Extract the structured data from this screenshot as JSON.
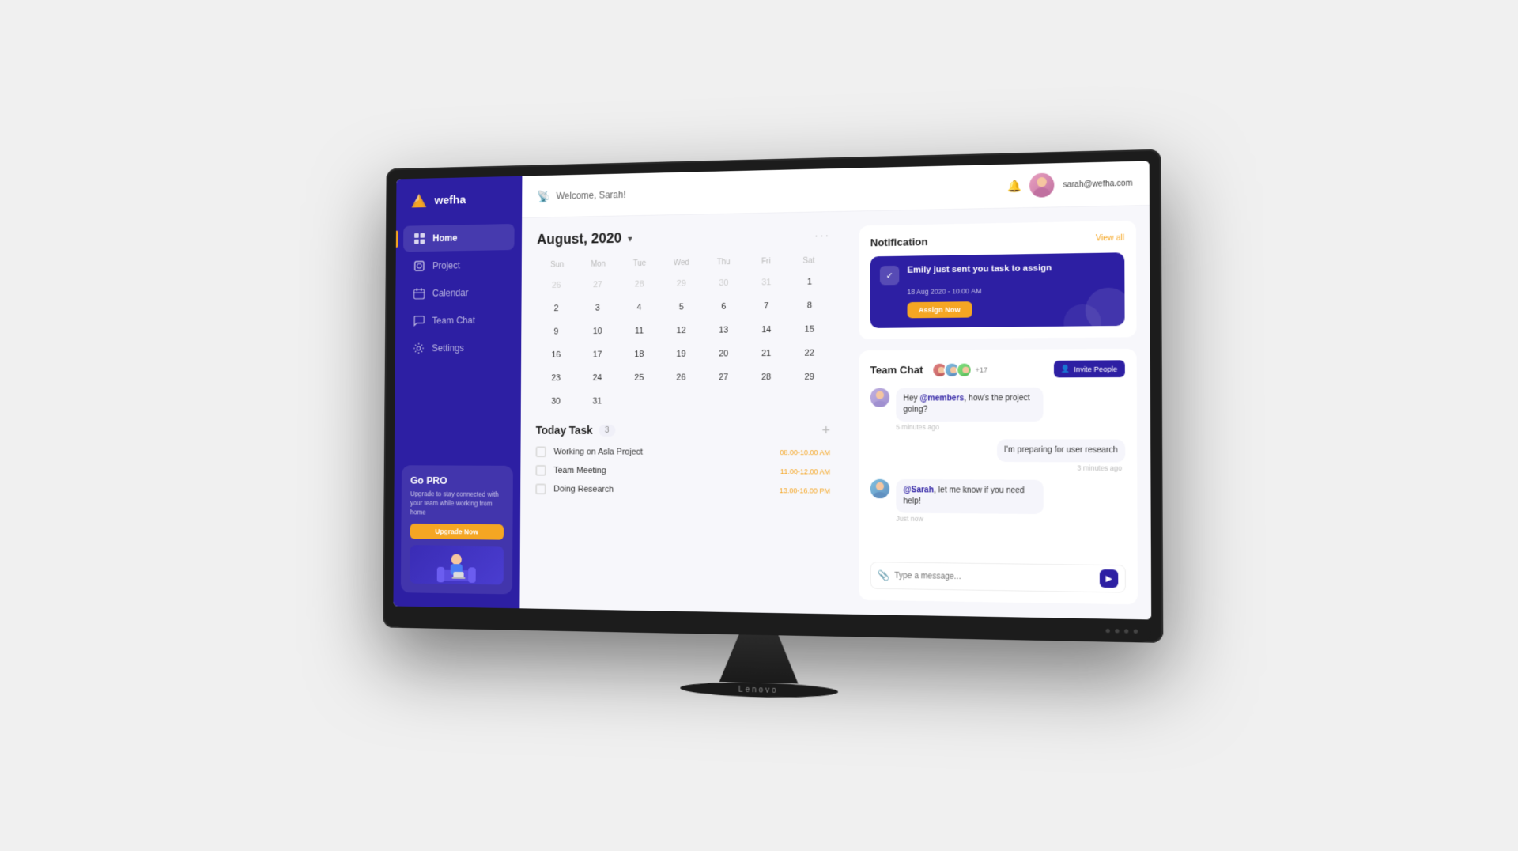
{
  "brand": {
    "name": "wefha"
  },
  "header": {
    "welcome": "Welcome, Sarah!",
    "user_email": "sarah@wefha.com"
  },
  "nav": {
    "items": [
      {
        "id": "home",
        "label": "Home",
        "active": true
      },
      {
        "id": "project",
        "label": "Project",
        "active": false
      },
      {
        "id": "calendar",
        "label": "Calendar",
        "active": false
      },
      {
        "id": "team-chat",
        "label": "Team Chat",
        "active": false
      },
      {
        "id": "settings",
        "label": "Settings",
        "active": false
      }
    ]
  },
  "go_pro": {
    "title": "Go PRO",
    "description": "Upgrade to stay connected with your team while working from home",
    "button_label": "Upgrade Now"
  },
  "calendar": {
    "title": "August, 2020",
    "days_of_week": [
      "Sun",
      "Mon",
      "Tue",
      "Wed",
      "Thu",
      "Fri",
      "Sat"
    ],
    "weeks": [
      [
        "26",
        "27",
        "28",
        "29",
        "30",
        "31",
        "1"
      ],
      [
        "2",
        "3",
        "4",
        "5",
        "6",
        "7",
        "8"
      ],
      [
        "9",
        "10",
        "11",
        "12",
        "13",
        "14",
        "15"
      ],
      [
        "16",
        "17",
        "18",
        "19",
        "20",
        "21",
        "22"
      ],
      [
        "23",
        "24",
        "25",
        "26",
        "27",
        "28",
        "29"
      ],
      [
        "30",
        "31",
        "",
        "",
        "",
        "",
        ""
      ]
    ],
    "today": "18",
    "other_month_first_row": [
      true,
      true,
      true,
      true,
      true,
      true,
      false
    ],
    "other_month_last_rows": [
      false,
      false,
      false,
      false,
      false,
      false,
      false
    ]
  },
  "today_task": {
    "title": "Today Task",
    "count": "3",
    "tasks": [
      {
        "name": "Working on Asla Project",
        "time": "08.00-10.00 AM"
      },
      {
        "name": "Team Meeting",
        "time": "11.00-12.00 AM"
      },
      {
        "name": "Doing Research",
        "time": "13.00-16.00 PM"
      }
    ]
  },
  "notification": {
    "title": "Notification",
    "view_all": "View all",
    "card": {
      "message": "Emily just sent you task to assign",
      "date": "18 Aug 2020 - 10.00 AM",
      "button_label": "Assign Now"
    }
  },
  "team_chat": {
    "title": "Team Chat",
    "members_count": "+17",
    "invite_button": "Invite People",
    "messages": [
      {
        "sender": "member1",
        "text_before": "Hey ",
        "mention": "@members",
        "text_after": ", how's the project going?",
        "time": "5 minutes ago",
        "sent": false
      },
      {
        "sender": "me",
        "text": "I'm preparing for user research",
        "time": "3 minutes ago",
        "sent": true
      },
      {
        "sender": "member2",
        "text_before": "",
        "mention": "@Sarah",
        "text_after": ", let me know if you need help!",
        "time": "Just now",
        "sent": false
      }
    ],
    "input_placeholder": "Type a message..."
  },
  "lenovo_label": "Lenovo"
}
